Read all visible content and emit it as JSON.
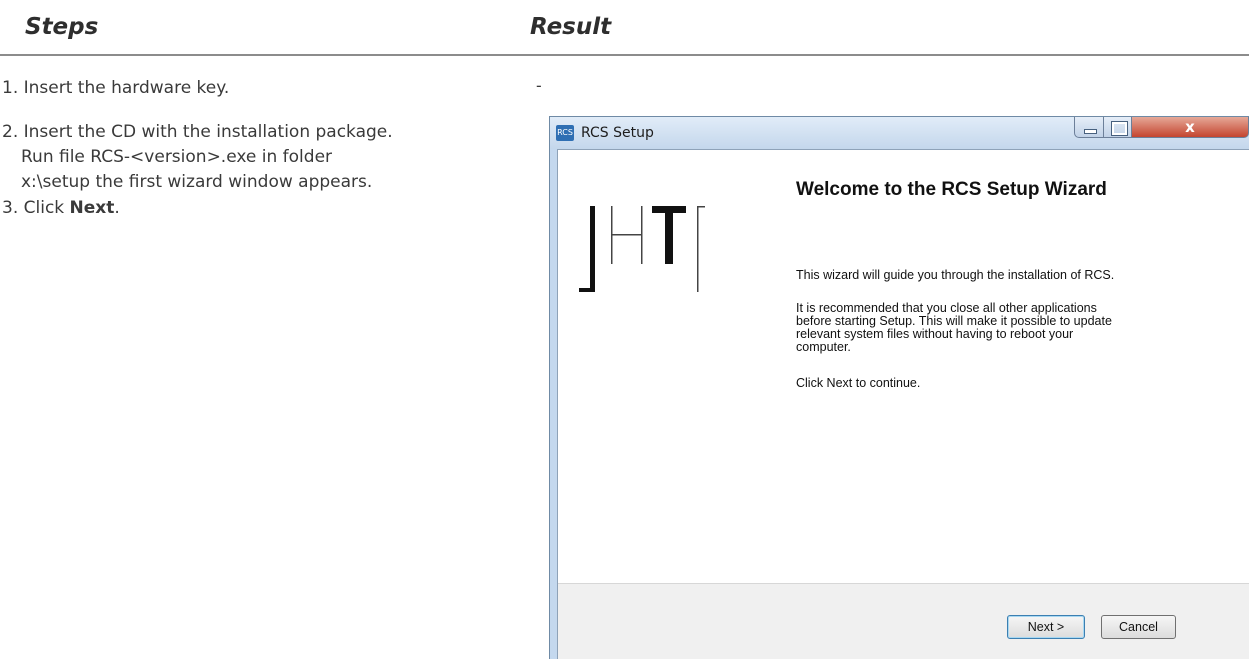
{
  "headers": {
    "steps": "Steps",
    "result": "Result"
  },
  "steps": [
    {
      "text": "1. Insert the hardware key."
    },
    {
      "line1": "2. Insert the CD with the installation package.",
      "line2": "Run file RCS-<version>.exe in folder",
      "line3": "x:\\setup the first wizard window appears."
    },
    {
      "prefix": "3. Click ",
      "bold": "Next",
      "suffix": "."
    }
  ],
  "result_step1": "-",
  "window": {
    "title": "RCS Setup",
    "icon_label": "RCS",
    "close_glyph": "x",
    "heading": "Welcome to the RCS Setup Wizard",
    "paragraph1": "This wizard will guide you through the installation of RCS.",
    "paragraph2_lines": [
      "It is recommended that you close all other applications",
      "before starting Setup. This will make it possible to update",
      "relevant system files without having to reboot your",
      "computer."
    ],
    "paragraph3": "Click Next to continue.",
    "next_label": "Next >",
    "cancel_label": "Cancel",
    "logo_text": "]HT["
  }
}
